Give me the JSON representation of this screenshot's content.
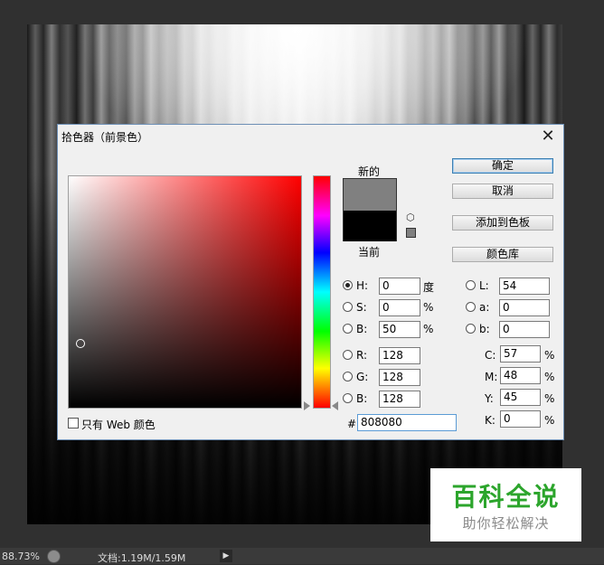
{
  "status_bar": {
    "zoom": "88.73%",
    "doc_size": "文档:1.19M/1.59M",
    "arrow": "▶"
  },
  "watermark": {
    "title": "百科全说",
    "subtitle": "助你轻松解决"
  },
  "dialog": {
    "title": "拾色器（前景色）",
    "close": "✕",
    "new_label": "新的",
    "current_label": "当前",
    "new_color": "#808080",
    "current_color": "#000000",
    "buttons": {
      "ok": "确定",
      "cancel": "取消",
      "add_to_swatches": "添加到色板",
      "color_libraries": "颜色库"
    },
    "hsb": {
      "h_label": "H:",
      "h_value": "0",
      "h_unit": "度",
      "s_label": "S:",
      "s_value": "0",
      "s_unit": "%",
      "b_label": "B:",
      "b_value": "50",
      "b_unit": "%"
    },
    "rgb": {
      "r_label": "R:",
      "r_value": "128",
      "g_label": "G:",
      "g_value": "128",
      "b_label": "B:",
      "b_value": "128"
    },
    "lab": {
      "l_label": "L:",
      "l_value": "54",
      "a_label": "a:",
      "a_value": "0",
      "b_label": "b:",
      "b_value": "0"
    },
    "cmyk": {
      "c_label": "C:",
      "c_value": "57",
      "m_label": "M:",
      "m_value": "48",
      "y_label": "Y:",
      "y_value": "45",
      "k_label": "K:",
      "k_value": "0",
      "unit": "%"
    },
    "hex": {
      "label": "#",
      "value": "808080"
    },
    "web_only_label": "只有 Web 颜色",
    "selected_mode": "H",
    "hue_color": "#ff0000",
    "icons": {
      "gamut_warning": "cube-icon",
      "websafe": "websafe-icon"
    }
  }
}
